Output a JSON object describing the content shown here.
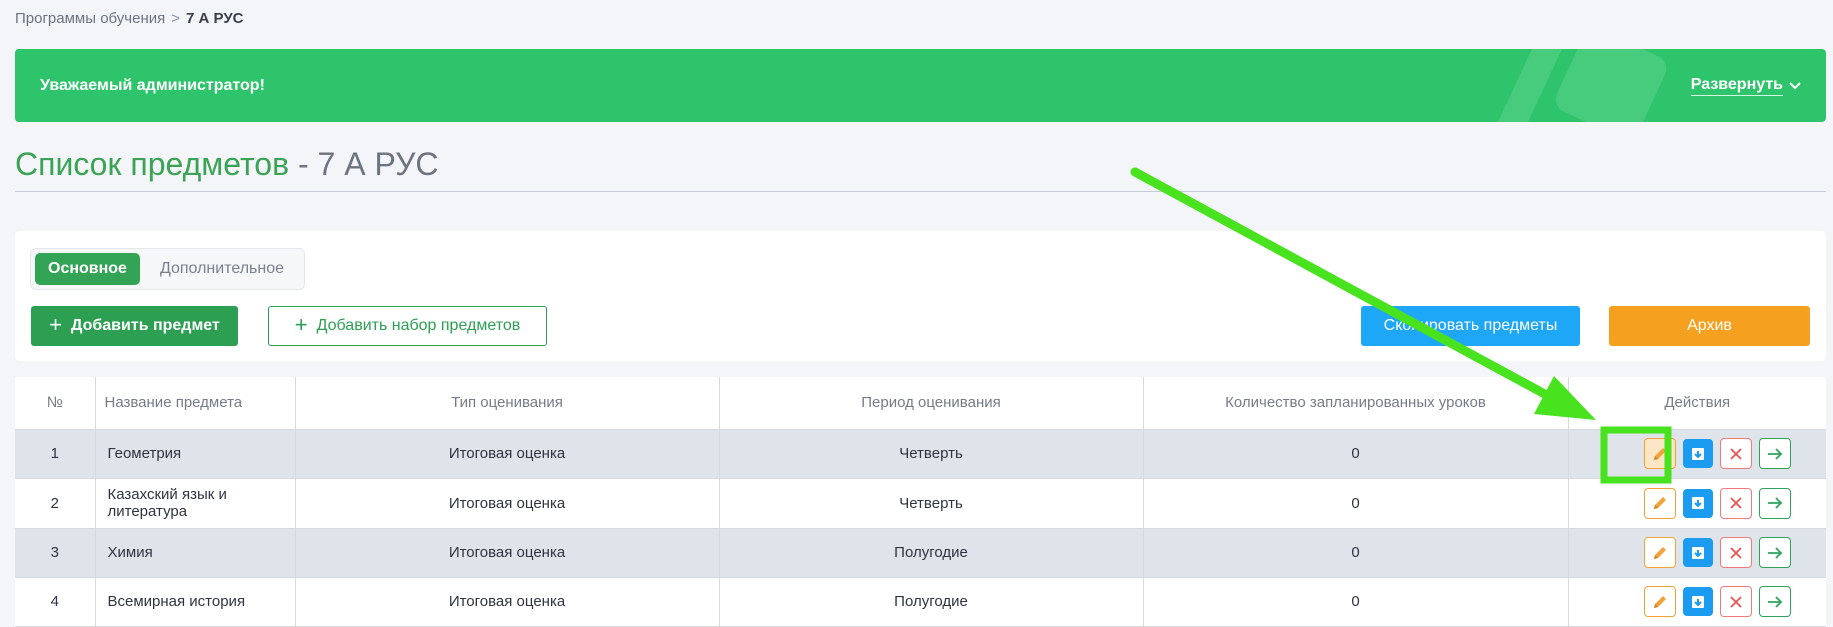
{
  "breadcrumb": {
    "items": [
      "Программы обучения",
      "7 А РУС"
    ],
    "separator": ">"
  },
  "banner": {
    "text": "Уважаемый администратор!",
    "toggle_label": "Развернуть"
  },
  "page": {
    "title_main": "Список предметов",
    "title_sub": " - 7 А РУС"
  },
  "tabs": [
    {
      "label": "Основное",
      "active": true
    },
    {
      "label": "Дополнительное",
      "active": false
    }
  ],
  "toolbar": {
    "add_subject": "Добавить предмет",
    "add_subject_set": "Добавить набор предметов",
    "copy_subjects": "Скопировать предметы",
    "archive": "Архив"
  },
  "table": {
    "headers": [
      "№",
      "Название предмета",
      "Тип оценивания",
      "Период оценивания",
      "Количество запланированных уроков",
      "Действия"
    ],
    "rows": [
      {
        "num": "1",
        "name": "Геометрия",
        "type": "Итоговая оценка",
        "period": "Четверть",
        "lessons": "0"
      },
      {
        "num": "2",
        "name": "Казахский язык и литература",
        "type": "Итоговая оценка",
        "period": "Четверть",
        "lessons": "0"
      },
      {
        "num": "3",
        "name": "Химия",
        "type": "Итоговая оценка",
        "period": "Полугодие",
        "lessons": "0"
      },
      {
        "num": "4",
        "name": "Всемирная история",
        "type": "Итоговая оценка",
        "period": "Полугодие",
        "lessons": "0"
      }
    ]
  },
  "icons": {
    "chevron": "chevron-down-icon",
    "plus": "plus-icon",
    "edit": "pencil-icon",
    "download": "download-icon",
    "delete": "close-icon",
    "go": "arrow-right-icon"
  },
  "colors": {
    "brand_green": "#2ec46b",
    "button_green": "#2d9f52",
    "copy_blue": "#1ea7f6",
    "archive_orange": "#f5a11f",
    "annotation_green": "#48e21f"
  }
}
